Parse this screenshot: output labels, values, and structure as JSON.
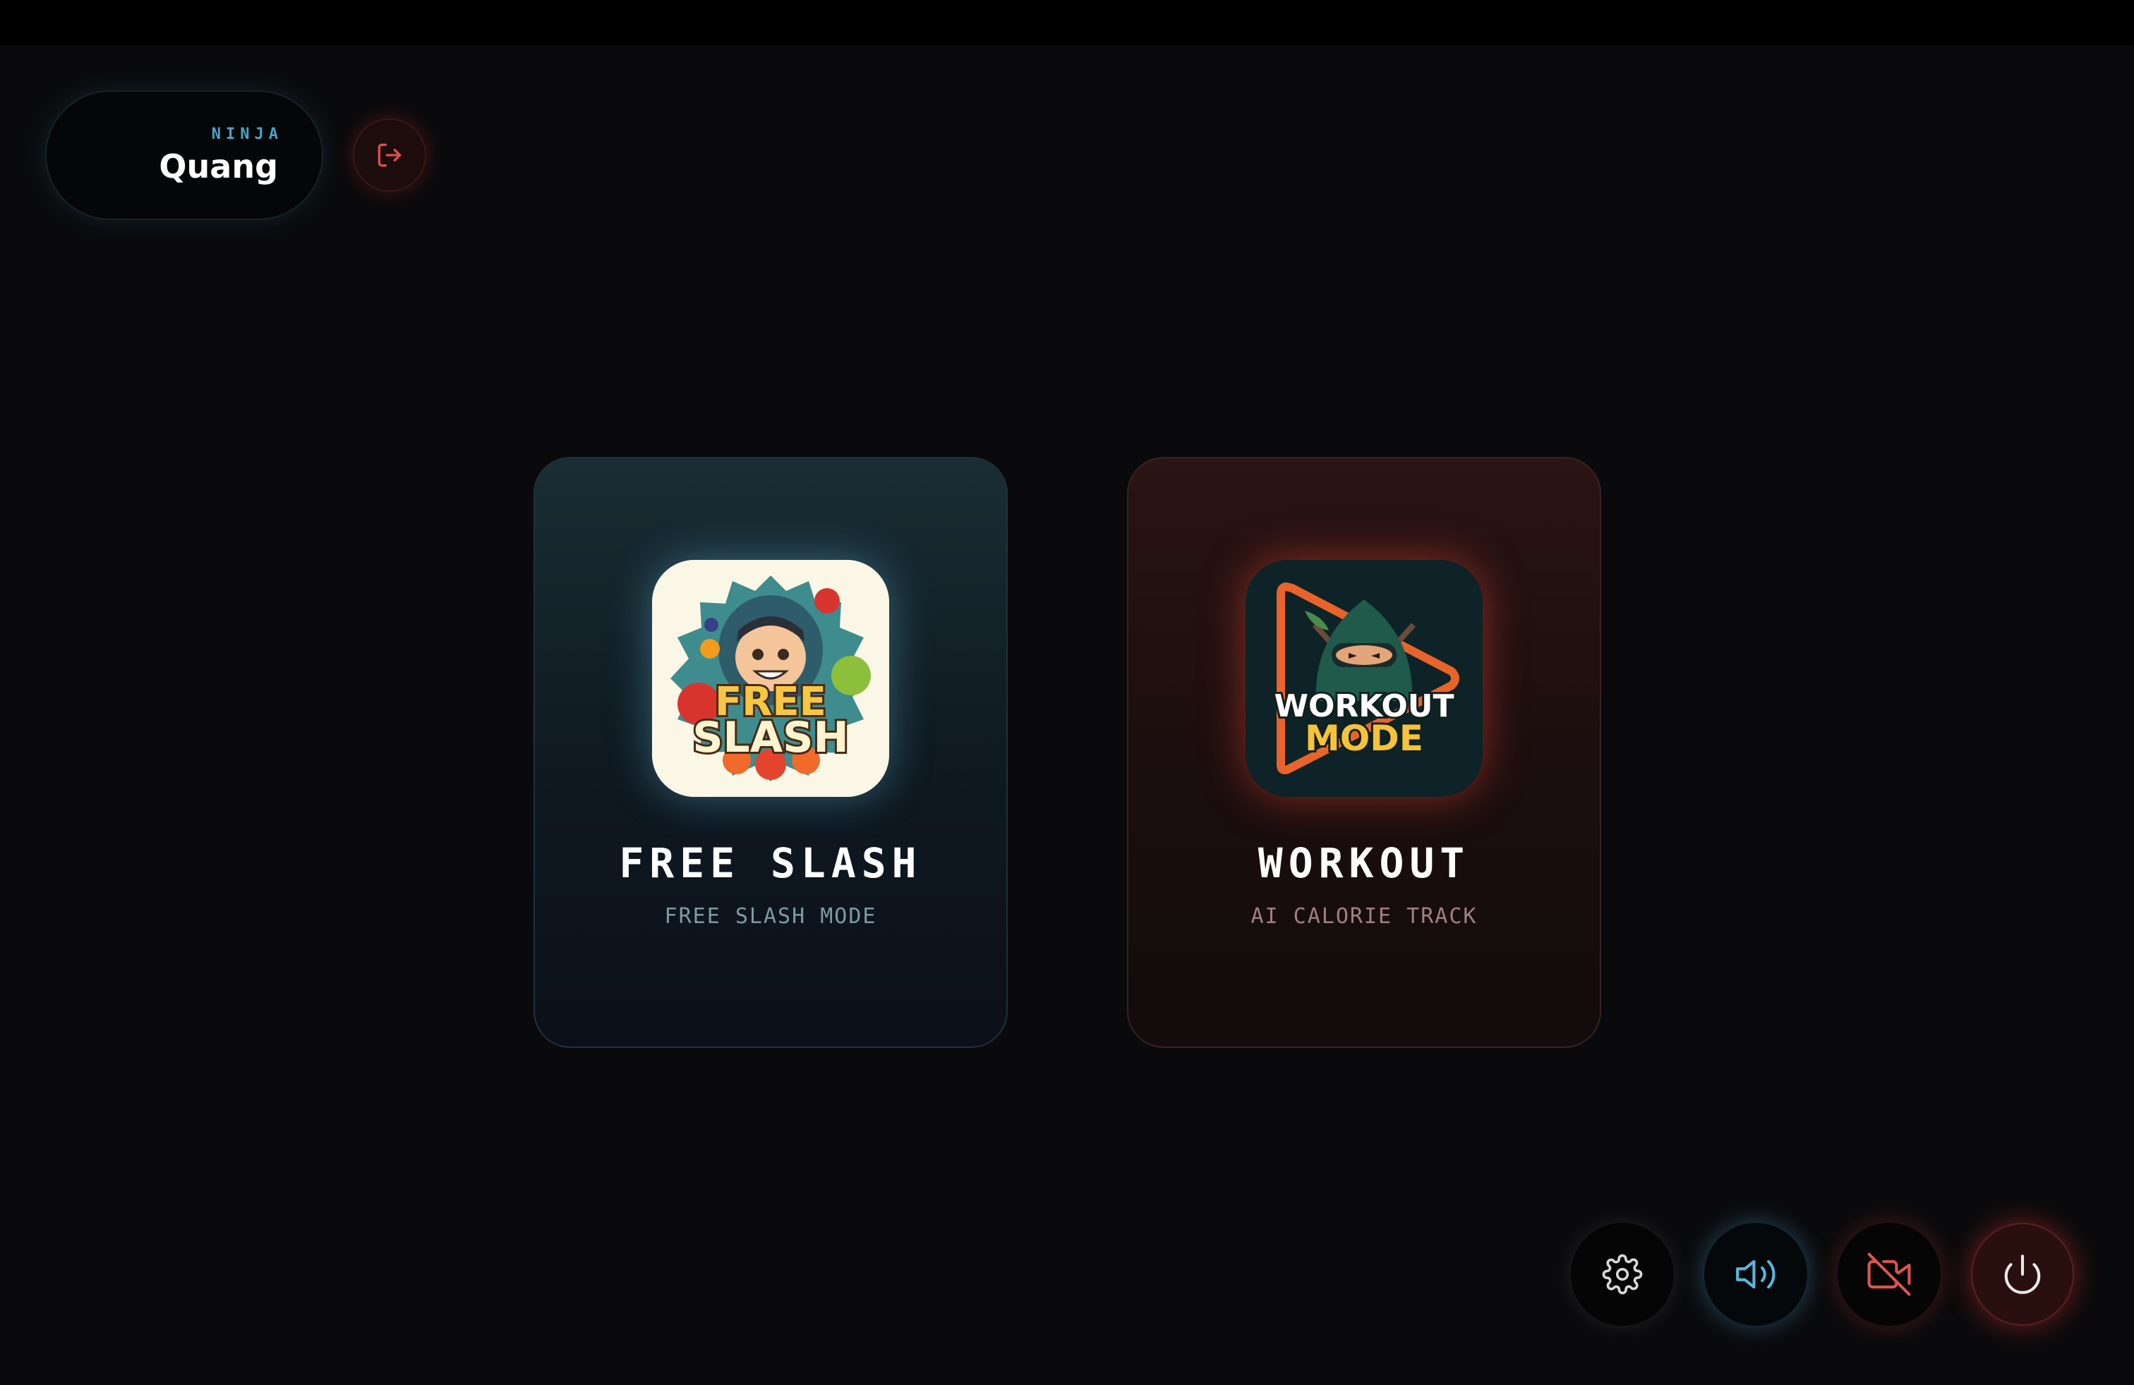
{
  "profile": {
    "role": "NINJA",
    "name": "Quang"
  },
  "logout": {
    "icon": "logout-icon",
    "color": "#e0504a"
  },
  "modes": [
    {
      "title": "FREE SLASH",
      "subtitle": "FREE SLASH MODE",
      "icon_text_line1": "FREE",
      "icon_text_line2": "SLASH",
      "accent": "#4aa3c6"
    },
    {
      "title": "WORKOUT",
      "subtitle": "AI CALORIE TRACK",
      "icon_text_line1": "WORKOUT",
      "icon_text_line2": "MODE",
      "accent": "#e0504a"
    }
  ],
  "controls": [
    {
      "icon": "gear-icon",
      "color": "#d8d8d8"
    },
    {
      "icon": "speaker-icon",
      "color": "#5bb4da"
    },
    {
      "icon": "camera-off-icon",
      "color": "#d9564e"
    },
    {
      "icon": "power-icon",
      "color": "#e8e8e8"
    }
  ]
}
